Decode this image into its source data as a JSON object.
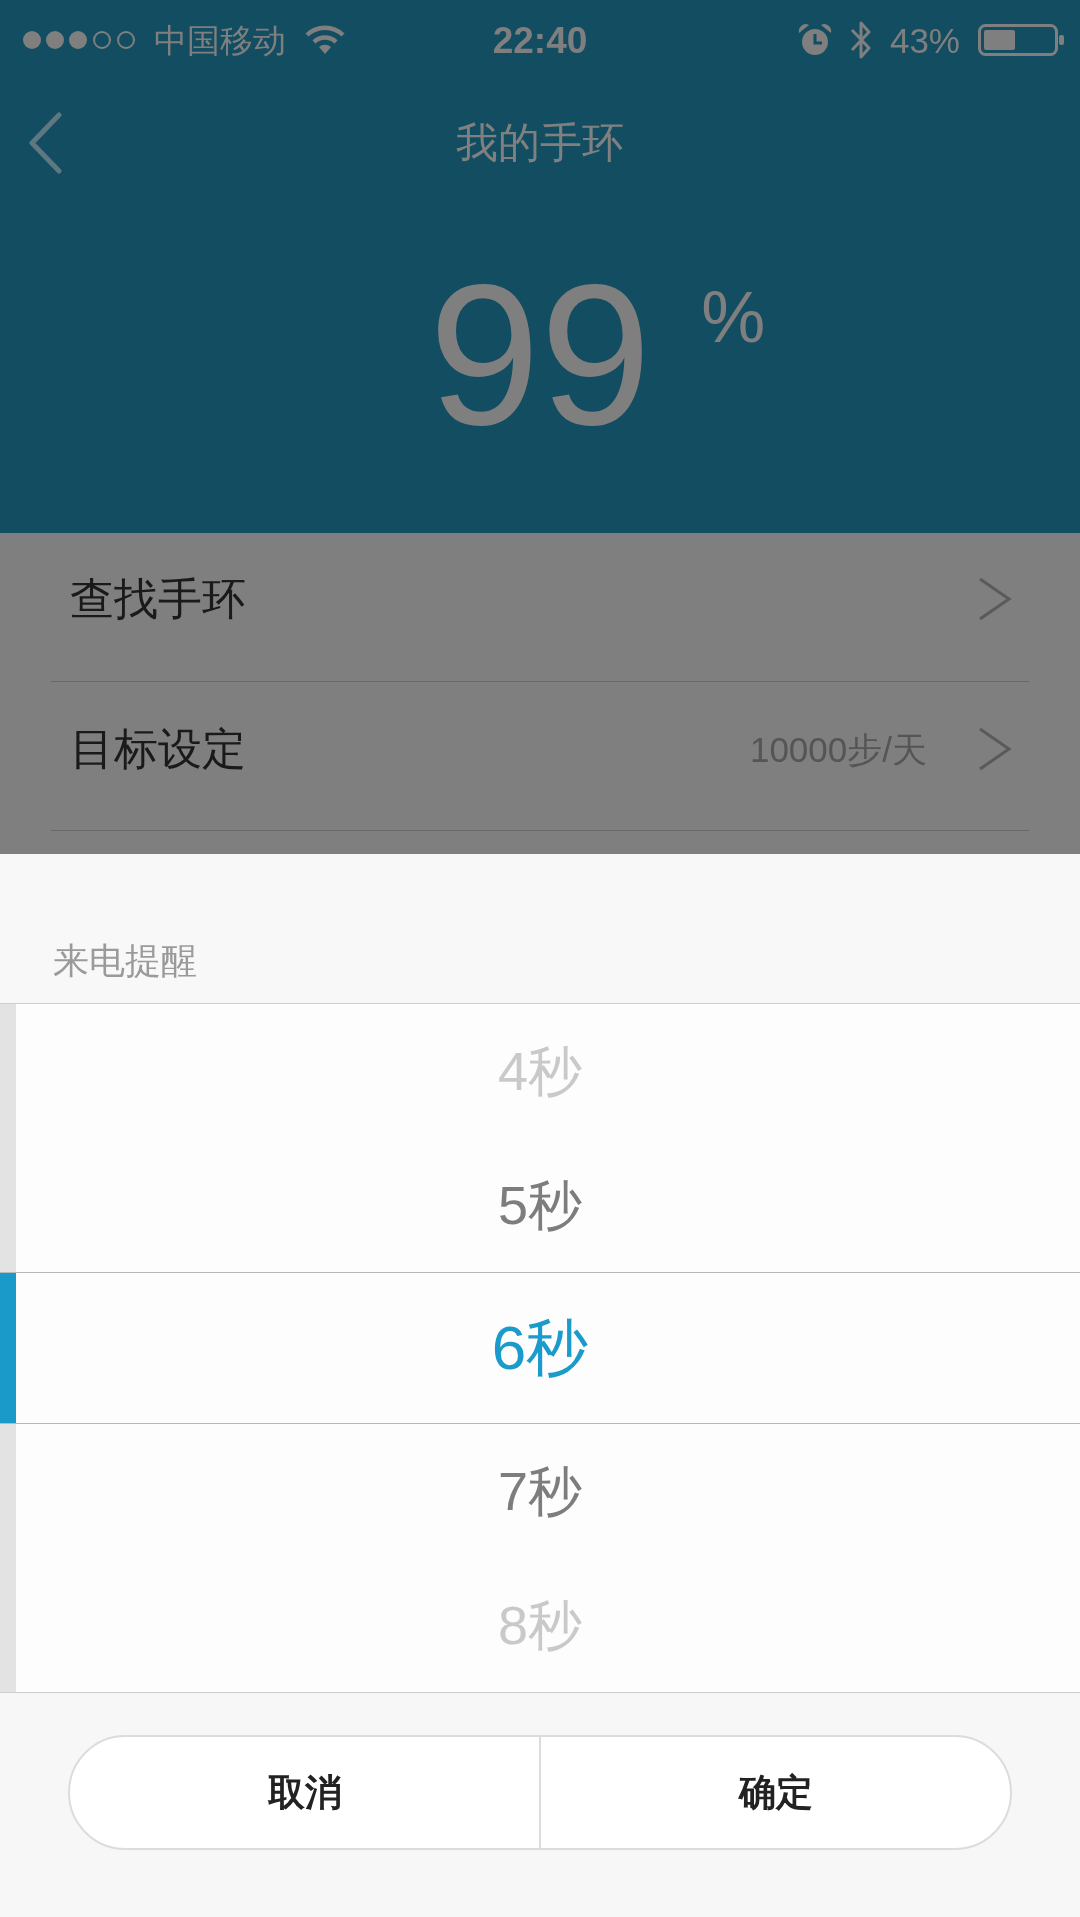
{
  "status_bar": {
    "carrier": "中国移动",
    "time": "22:40",
    "battery": "43%"
  },
  "nav_bar": {
    "title": "我的手环"
  },
  "band_battery": {
    "value": "99",
    "unit": "%"
  },
  "settings_list": [
    {
      "label": "查找手环"
    },
    {
      "label": "目标设定",
      "value": "10000步/天"
    }
  ],
  "picker_sheet": {
    "title": "来电提醒",
    "options": [
      {
        "label": "4秒",
        "selected": false
      },
      {
        "label": "5秒",
        "selected": false
      },
      {
        "label": "6秒",
        "selected": true
      },
      {
        "label": "7秒",
        "selected": false
      },
      {
        "label": "8秒",
        "selected": false
      }
    ],
    "buttons": [
      {
        "label": "取消"
      },
      {
        "label": "确定"
      }
    ]
  }
}
